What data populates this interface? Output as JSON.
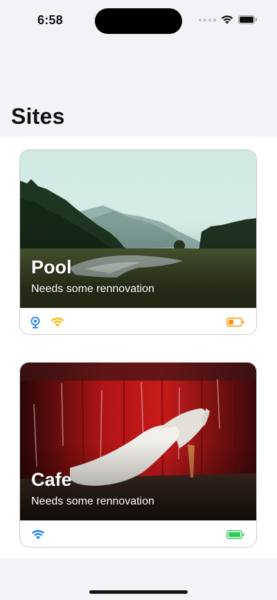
{
  "status_bar": {
    "time": "6:58"
  },
  "page": {
    "title": "Sites"
  },
  "sites": [
    {
      "name": "Pool",
      "subtitle": "Needs some rennovation",
      "image": "landscape-photo",
      "icons": [
        "camera-icon",
        "wifi-icon",
        "battery-icon"
      ],
      "wifi_color": "#f5b800",
      "battery_color": "#ff9500",
      "battery_level": 0.35
    },
    {
      "name": "Cafe",
      "subtitle": "Needs some rennovation",
      "image": "shoes-photo",
      "icons": [
        "wifi-icon",
        "battery-icon"
      ],
      "wifi_color": "#1a7ff5",
      "battery_color": "#34c759",
      "battery_level": 0.95
    }
  ],
  "colors": {
    "background": "#f2f2f7",
    "card_border": "#c9c9ce",
    "camera_blue": "#1a7ff5"
  }
}
